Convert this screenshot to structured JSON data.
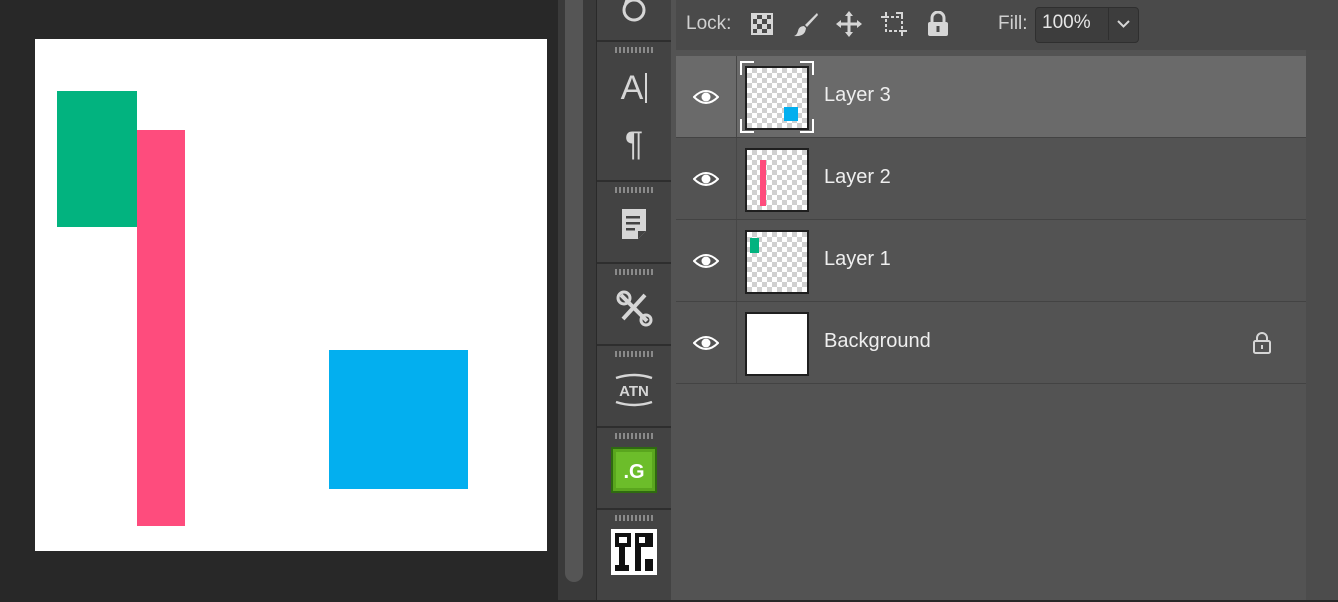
{
  "colors": {
    "green": "#02b37f",
    "pink": "#fe4c7d",
    "blue": "#03afef",
    "panel": "#535353",
    "selected_row": "#6a6a6a"
  },
  "canvas": {
    "shapes": [
      {
        "name": "green-rectangle",
        "color": "green"
      },
      {
        "name": "pink-rectangle",
        "color": "pink"
      },
      {
        "name": "blue-square",
        "color": "blue"
      }
    ]
  },
  "toolstrip": {
    "icons": [
      "history-icon",
      "character-icon",
      "paragraph-icon",
      "notes-icon",
      "tools-icon",
      "actions-icon",
      "plugin-g-icon",
      "plugin-logo-icon"
    ]
  },
  "layers_panel": {
    "lock_label": "Lock:",
    "lock_icons": [
      "lock-transparent-pixels-icon",
      "lock-image-pixels-icon",
      "lock-position-icon",
      "lock-artboard-icon",
      "lock-all-icon"
    ],
    "fill_label": "Fill:",
    "fill_value": "100%",
    "layers": [
      {
        "name": "Layer 3",
        "selected": true,
        "visible": true
      },
      {
        "name": "Layer 2",
        "selected": false,
        "visible": true
      },
      {
        "name": "Layer 1",
        "selected": false,
        "visible": true
      },
      {
        "name": "Background",
        "selected": false,
        "visible": true,
        "locked": true
      }
    ]
  }
}
